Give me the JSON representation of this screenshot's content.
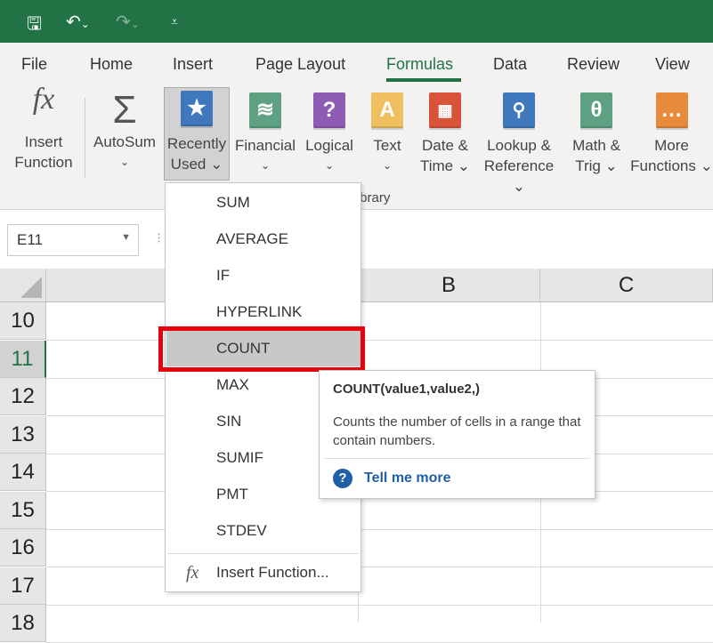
{
  "qat": {
    "save_icon": "save-icon",
    "undo_icon": "undo-icon",
    "redo_icon": "redo-icon",
    "customize_icon": "customize-icon"
  },
  "tabs": [
    "File",
    "Home",
    "Insert",
    "Page Layout",
    "Formulas",
    "Data",
    "Review",
    "View"
  ],
  "active_tab": "Formulas",
  "ribbon": {
    "buttons": [
      {
        "line1": "Insert",
        "line2": "Function",
        "icon": "fx-icon"
      },
      {
        "line1": "AutoSum",
        "line2": "⌄",
        "icon": "sigma-icon"
      },
      {
        "line1": "Recently",
        "line2": "Used ⌄",
        "icon": "star-book-icon",
        "color": "#3f78bd"
      },
      {
        "line1": "Financial",
        "line2": "⌄",
        "icon": "coins-book-icon",
        "color": "#5fa083"
      },
      {
        "line1": "Logical",
        "line2": "⌄",
        "icon": "question-book-icon",
        "color": "#8e5bb5"
      },
      {
        "line1": "Text",
        "line2": "⌄",
        "icon": "text-book-icon",
        "color": "#f0c060"
      },
      {
        "line1": "Date &",
        "line2": "Time ⌄",
        "icon": "calendar-book-icon",
        "color": "#d9533a"
      },
      {
        "line1": "Lookup &",
        "line2": "Reference ⌄",
        "icon": "magnifier-book-icon",
        "color": "#3f78bd"
      },
      {
        "line1": "Math &",
        "line2": "Trig ⌄",
        "icon": "theta-book-icon",
        "color": "#5fa083"
      },
      {
        "line1": "More",
        "line2": "Functions ⌄",
        "icon": "more-book-icon",
        "color": "#e88a3c"
      }
    ],
    "group_label": "n Library"
  },
  "namebox": "E11",
  "columns": [
    "B",
    "C"
  ],
  "rows": [
    "10",
    "11",
    "12",
    "13",
    "14",
    "15",
    "16",
    "17",
    "18"
  ],
  "active_row": "11",
  "menu": {
    "items": [
      "SUM",
      "AVERAGE",
      "IF",
      "HYPERLINK",
      "COUNT",
      "MAX",
      "SIN",
      "SUMIF",
      "PMT",
      "STDEV"
    ],
    "highlighted": "COUNT",
    "insert_function": "Insert Function..."
  },
  "tooltip": {
    "title": "COUNT(value1,value2,)",
    "body": "Counts the number of cells in a range that contain numbers.",
    "link": "Tell me more"
  },
  "colors": {
    "accent": "#217346",
    "highlight_box": "#e8000b",
    "link": "#1e5fa8"
  }
}
